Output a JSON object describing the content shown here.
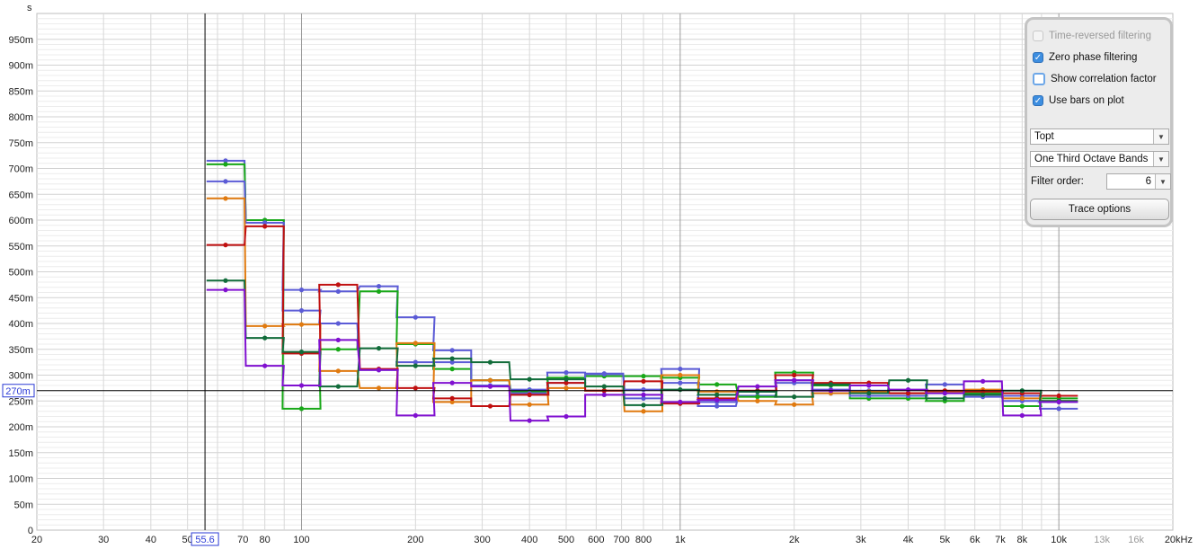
{
  "y_unit_label": "s",
  "cursor": {
    "y_readout": "270m",
    "x_readout": "55.6"
  },
  "panel": {
    "time_reversed": {
      "label": "Time-reversed filtering",
      "checked": false,
      "enabled": false
    },
    "zero_phase": {
      "label": "Zero phase filtering",
      "checked": true
    },
    "show_corr": {
      "label": "Show correlation factor",
      "checked": false
    },
    "use_bars": {
      "label": "Use bars on plot",
      "checked": true
    },
    "param_select": "Topt",
    "bands_select": "One Third Octave Bands",
    "filter_order_label": "Filter order:",
    "filter_order_value": "6",
    "trace_options": "Trace options"
  },
  "chart_data": {
    "type": "line",
    "xscale": "log",
    "xlim": [
      20,
      20000
    ],
    "ylim": [
      0,
      1.0
    ],
    "y_ticks": [
      {
        "v": 0.05,
        "label": "50m"
      },
      {
        "v": 0.1,
        "label": "100m"
      },
      {
        "v": 0.15,
        "label": "150m"
      },
      {
        "v": 0.2,
        "label": "200m"
      },
      {
        "v": 0.25,
        "label": "250m"
      },
      {
        "v": 0.3,
        "label": "300m"
      },
      {
        "v": 0.35,
        "label": "350m"
      },
      {
        "v": 0.4,
        "label": "400m"
      },
      {
        "v": 0.45,
        "label": "450m"
      },
      {
        "v": 0.5,
        "label": "500m"
      },
      {
        "v": 0.55,
        "label": "550m"
      },
      {
        "v": 0.6,
        "label": "600m"
      },
      {
        "v": 0.65,
        "label": "650m"
      },
      {
        "v": 0.7,
        "label": "700m"
      },
      {
        "v": 0.75,
        "label": "750m"
      },
      {
        "v": 0.8,
        "label": "800m"
      },
      {
        "v": 0.85,
        "label": "850m"
      },
      {
        "v": 0.9,
        "label": "900m"
      },
      {
        "v": 0.95,
        "label": "950m"
      }
    ],
    "y_zero_label": "0",
    "x_ticks": [
      {
        "v": 20,
        "label": "20"
      },
      {
        "v": 30,
        "label": "30"
      },
      {
        "v": 40,
        "label": "40"
      },
      {
        "v": 50,
        "label": "50"
      },
      {
        "v": 70,
        "label": "70"
      },
      {
        "v": 80,
        "label": "80"
      },
      {
        "v": 100,
        "label": "100"
      },
      {
        "v": 200,
        "label": "200"
      },
      {
        "v": 300,
        "label": "300"
      },
      {
        "v": 400,
        "label": "400"
      },
      {
        "v": 500,
        "label": "500"
      },
      {
        "v": 600,
        "label": "600"
      },
      {
        "v": 700,
        "label": "700"
      },
      {
        "v": 800,
        "label": "800"
      },
      {
        "v": 1000,
        "label": "1k"
      },
      {
        "v": 2000,
        "label": "2k"
      },
      {
        "v": 3000,
        "label": "3k"
      },
      {
        "v": 4000,
        "label": "4k"
      },
      {
        "v": 5000,
        "label": "5k"
      },
      {
        "v": 6000,
        "label": "6k"
      },
      {
        "v": 7000,
        "label": "7k"
      },
      {
        "v": 8000,
        "label": "8k"
      },
      {
        "v": 10000,
        "label": "10k"
      },
      {
        "v": 13000,
        "label": "13k",
        "dim": true
      },
      {
        "v": 16000,
        "label": "16k",
        "dim": true
      },
      {
        "v": 20000,
        "label": "20kHz"
      }
    ],
    "cursor": {
      "x": 55.6,
      "y": 0.27
    },
    "bands": [
      63,
      80,
      100,
      125,
      160,
      200,
      250,
      315,
      400,
      500,
      630,
      800,
      1000,
      1250,
      1600,
      2000,
      2500,
      3150,
      4000,
      5000,
      6300,
      8000,
      10000
    ],
    "series": [
      {
        "color": "#5b5bd6",
        "values": [
          0.715,
          0.6,
          0.465,
          0.462,
          0.472,
          0.412,
          0.348,
          0.29,
          0.272,
          0.305,
          0.303,
          0.272,
          0.312,
          0.24,
          0.26,
          0.285,
          0.265,
          0.27,
          0.265,
          0.282,
          0.258,
          0.25,
          0.248
        ]
      },
      {
        "color": "#18a818",
        "values": [
          0.708,
          0.6,
          0.235,
          0.35,
          0.462,
          0.36,
          0.312,
          0.29,
          0.268,
          0.295,
          0.298,
          0.298,
          0.295,
          0.282,
          0.258,
          0.305,
          0.28,
          0.255,
          0.255,
          0.25,
          0.265,
          0.24,
          0.255
        ]
      },
      {
        "color": "#5b5bd6",
        "values": [
          0.675,
          0.595,
          0.425,
          0.4,
          0.31,
          0.325,
          0.325,
          0.28,
          0.265,
          0.285,
          0.302,
          0.255,
          0.285,
          0.248,
          0.268,
          0.29,
          0.272,
          0.26,
          0.26,
          0.265,
          0.262,
          0.26,
          0.235
        ]
      },
      {
        "color": "#e07a10",
        "values": [
          0.642,
          0.395,
          0.398,
          0.308,
          0.275,
          0.362,
          0.248,
          0.29,
          0.243,
          0.275,
          0.27,
          0.23,
          0.3,
          0.268,
          0.25,
          0.243,
          0.265,
          0.268,
          0.265,
          0.268,
          0.272,
          0.255,
          0.25
        ]
      },
      {
        "color": "#c01010",
        "values": [
          0.552,
          0.588,
          0.342,
          0.475,
          0.312,
          0.275,
          0.255,
          0.24,
          0.262,
          0.285,
          0.27,
          0.288,
          0.245,
          0.255,
          0.27,
          0.3,
          0.285,
          0.285,
          0.265,
          0.27,
          0.268,
          0.265,
          0.26
        ]
      },
      {
        "color": "#116c3a",
        "values": [
          0.483,
          0.372,
          0.345,
          0.278,
          0.352,
          0.318,
          0.332,
          0.325,
          0.292,
          0.292,
          0.278,
          0.242,
          0.272,
          0.262,
          0.268,
          0.258,
          0.282,
          0.265,
          0.29,
          0.255,
          0.262,
          0.27,
          0.25
        ]
      },
      {
        "color": "#8010d0",
        "values": [
          0.465,
          0.318,
          0.28,
          0.368,
          0.31,
          0.222,
          0.285,
          0.278,
          0.212,
          0.22,
          0.262,
          0.262,
          0.248,
          0.252,
          0.278,
          0.29,
          0.27,
          0.28,
          0.272,
          0.265,
          0.288,
          0.222,
          0.248
        ]
      }
    ]
  }
}
